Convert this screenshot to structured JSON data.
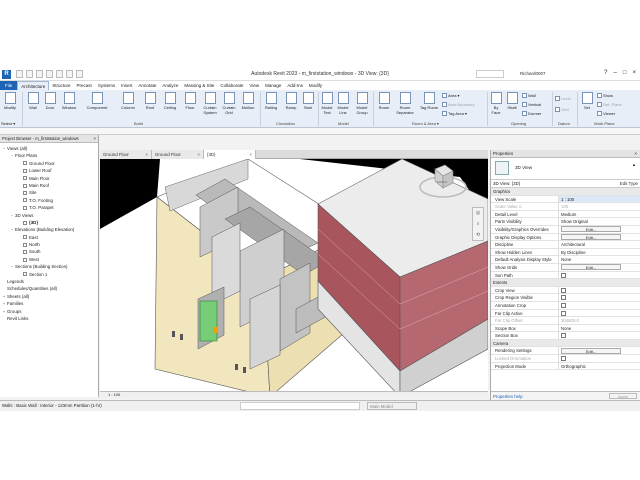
{
  "titlebar": {
    "app_letter": "R",
    "title": "Autodesk Revit 2023 - m_firststation_windows - 3D View: {3D}",
    "search_placeholder": "",
    "user": "Richard0007",
    "help": "?",
    "minimize": "–",
    "maximize": "□",
    "close": "×"
  },
  "tabs": [
    "File",
    "Architecture",
    "Structure",
    "Precast",
    "Systems",
    "Insert",
    "Annotate",
    "Analyze",
    "Massing & Site",
    "Collaborate",
    "View",
    "Manage",
    "Add-Ins",
    "Modify"
  ],
  "ribbon": {
    "modify": "Modify",
    "select": "Select ▾",
    "build_buttons": [
      "Wall",
      "Door",
      "Window",
      "Component",
      "Column",
      "Roof",
      "Ceiling",
      "Floor",
      "Curtain System",
      "Curtain Grid",
      "Mullion"
    ],
    "circulation_buttons": [
      "Railing",
      "Ramp",
      "Stair"
    ],
    "model_buttons": [
      "Model Text",
      "Model Line",
      "Model Group"
    ],
    "room_buttons": [
      "Room",
      "Room Separator",
      "Tag Room"
    ],
    "area_items": [
      "Area ▾",
      "Area Boundary",
      "Tag Area ▾"
    ],
    "opening_buttons": [
      "By Face",
      "Shaft"
    ],
    "opening_small": [
      "Wall",
      "Vertical",
      "Dormer"
    ],
    "datum_items": [
      "Level",
      "Grid"
    ],
    "workplane_button": "Set",
    "workplane_small": [
      "Show",
      "Ref. Plane",
      "Viewer"
    ],
    "panels": [
      "Build",
      "Circulation",
      "Model",
      "Room & Area ▾",
      "Opening",
      "Datum",
      "Work Plane"
    ]
  },
  "options_bar": {
    "select": "Select ▾"
  },
  "project_browser": {
    "title": "Project Browser - m_firststation_windows",
    "close": "×",
    "tree": [
      {
        "label": "Views (all)",
        "level": 0,
        "toggle": "−",
        "bold": false
      },
      {
        "label": "Floor Plans",
        "level": 1,
        "toggle": "−",
        "bold": false
      },
      {
        "label": "Ground Floor",
        "level": 2,
        "toggle": "",
        "bold": false
      },
      {
        "label": "Lower Roof",
        "level": 2,
        "toggle": "",
        "bold": false
      },
      {
        "label": "Main Floor",
        "level": 2,
        "toggle": "",
        "bold": false
      },
      {
        "label": "Main Roof",
        "level": 2,
        "toggle": "",
        "bold": false
      },
      {
        "label": "Site",
        "level": 2,
        "toggle": "",
        "bold": false
      },
      {
        "label": "T.O. Footing",
        "level": 2,
        "toggle": "",
        "bold": false
      },
      {
        "label": "T.O. Parapet",
        "level": 2,
        "toggle": "",
        "bold": false
      },
      {
        "label": "3D Views",
        "level": 1,
        "toggle": "−",
        "bold": false
      },
      {
        "label": "{3D}",
        "level": 2,
        "toggle": "",
        "bold": true
      },
      {
        "label": "Elevations (Building Elevation)",
        "level": 1,
        "toggle": "−",
        "bold": false
      },
      {
        "label": "East",
        "level": 2,
        "toggle": "",
        "bold": false
      },
      {
        "label": "North",
        "level": 2,
        "toggle": "",
        "bold": false
      },
      {
        "label": "South",
        "level": 2,
        "toggle": "",
        "bold": false
      },
      {
        "label": "West",
        "level": 2,
        "toggle": "",
        "bold": false
      },
      {
        "label": "Sections (Building Section)",
        "level": 1,
        "toggle": "−",
        "bold": false
      },
      {
        "label": "Section 1",
        "level": 2,
        "toggle": "",
        "bold": false
      },
      {
        "label": "Legends",
        "level": 0,
        "toggle": "",
        "bold": false
      },
      {
        "label": "Schedules/Quantities (all)",
        "level": 0,
        "toggle": "",
        "bold": false
      },
      {
        "label": "Sheets (all)",
        "level": 0,
        "toggle": "+",
        "bold": false
      },
      {
        "label": "Families",
        "level": 0,
        "toggle": "+",
        "bold": false
      },
      {
        "label": "Groups",
        "level": 0,
        "toggle": "+",
        "bold": false
      },
      {
        "label": "Revit Links",
        "level": 0,
        "toggle": "",
        "bold": false
      }
    ]
  },
  "view_tabs": [
    {
      "label": "Ground Floor",
      "close": "×"
    },
    {
      "label": "Ground Floor",
      "close": "×"
    },
    {
      "label": "{3D}",
      "close": "×"
    }
  ],
  "viewcube": {
    "face": "FRONT"
  },
  "view_control": {
    "scale": "1 : 100"
  },
  "properties": {
    "title": "Properties",
    "close": "×",
    "type_name": "3D View",
    "filter": "3D View: {3D}",
    "edit_type": "Edit Type",
    "rows": [
      {
        "kind": "group",
        "name": "Graphics"
      },
      {
        "kind": "value",
        "name": "View Scale",
        "value": "1 : 100",
        "sel": true
      },
      {
        "kind": "value",
        "name": "Scale Value    1:",
        "value": "100",
        "dim": true
      },
      {
        "kind": "value",
        "name": "Detail Level",
        "value": "Medium"
      },
      {
        "kind": "value",
        "name": "Parts Visibility",
        "value": "Show Original"
      },
      {
        "kind": "button",
        "name": "Visibility/Graphics Overrides",
        "value": "Edit..."
      },
      {
        "kind": "button",
        "name": "Graphic Display Options",
        "value": "Edit..."
      },
      {
        "kind": "value",
        "name": "Discipline",
        "value": "Architectural"
      },
      {
        "kind": "value",
        "name": "Show Hidden Lines",
        "value": "By Discipline"
      },
      {
        "kind": "value",
        "name": "Default Analysis Display Style",
        "value": "None"
      },
      {
        "kind": "button",
        "name": "Show Grids",
        "value": "Edit..."
      },
      {
        "kind": "check",
        "name": "Sun Path",
        "value": ""
      },
      {
        "kind": "group",
        "name": "Extents"
      },
      {
        "kind": "check",
        "name": "Crop View",
        "value": ""
      },
      {
        "kind": "check",
        "name": "Crop Region Visible",
        "value": ""
      },
      {
        "kind": "check",
        "name": "Annotation Crop",
        "value": ""
      },
      {
        "kind": "check",
        "name": "Far Clip Active",
        "value": ""
      },
      {
        "kind": "value",
        "name": "Far Clip Offset",
        "value": "304800.0",
        "dim": true
      },
      {
        "kind": "value",
        "name": "Scope Box",
        "value": "None"
      },
      {
        "kind": "check",
        "name": "Section Box",
        "value": ""
      },
      {
        "kind": "group",
        "name": "Camera"
      },
      {
        "kind": "button",
        "name": "Rendering Settings",
        "value": "Edit..."
      },
      {
        "kind": "check",
        "name": "Locked Orientation",
        "value": "",
        "dim": true
      },
      {
        "kind": "value",
        "name": "Projection Mode",
        "value": "Orthographic"
      }
    ],
    "help": "Properties help",
    "apply": "Apply"
  },
  "status": {
    "message": "Walls : Basic Wall : Interior - 123mm Partition (1-hr)",
    "model": "Main Model"
  },
  "colors": {
    "accent": "#1e63b4",
    "ribbon_bg": "#e7eef7",
    "selected_wall": "#6ed36e",
    "roof_red": "#a9555e",
    "exterior_wall": "#f2e6bf"
  }
}
